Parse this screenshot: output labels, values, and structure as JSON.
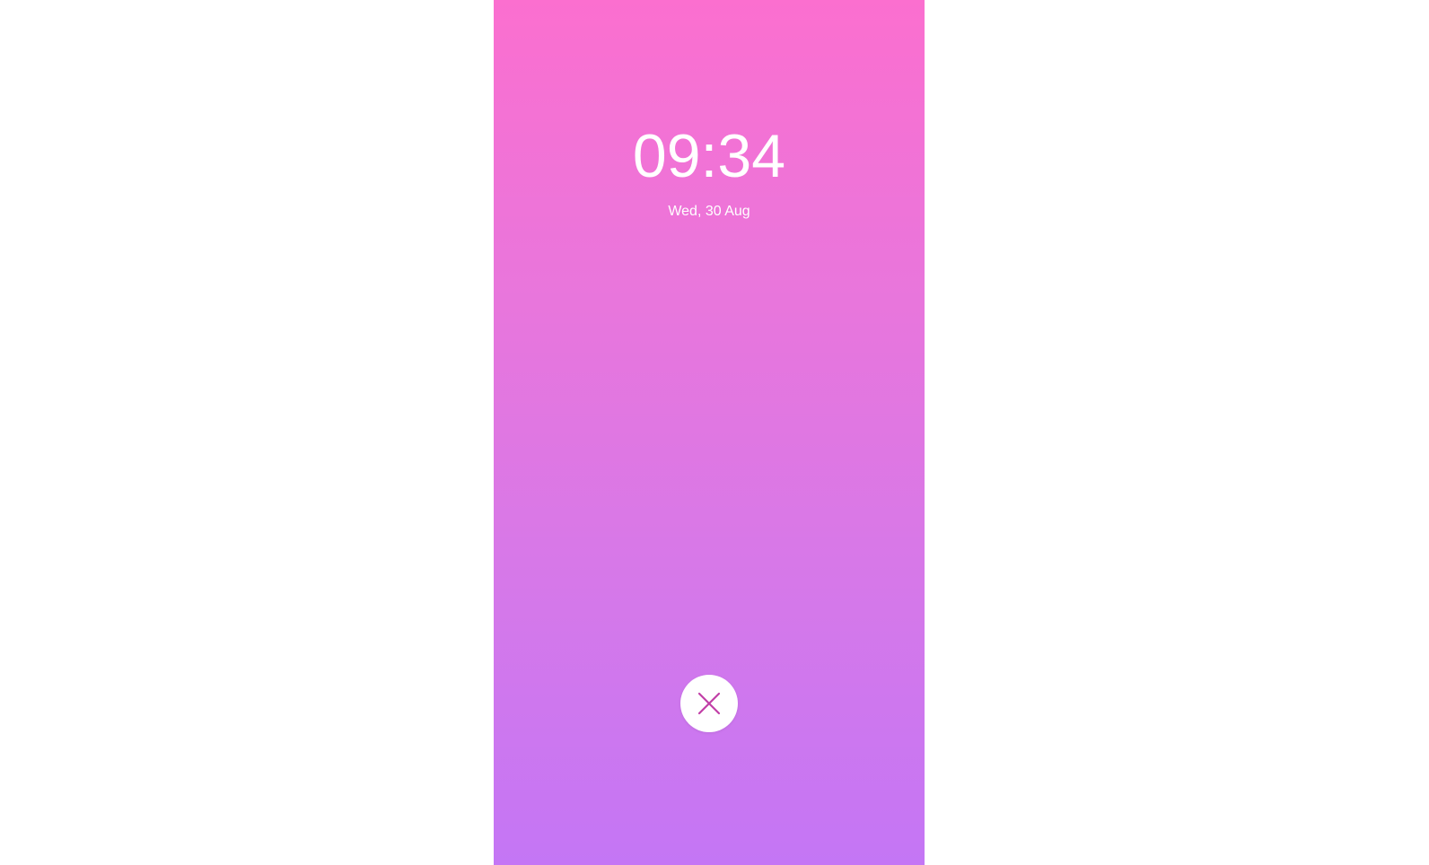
{
  "lock_screen": {
    "time": "09:34",
    "date": "Wed, 30 Aug"
  },
  "dismiss_button": {
    "icon": "close-icon",
    "icon_color": "#c13fa7",
    "background": "#ffffff"
  },
  "colors": {
    "gradient_top": "#fb6fcf",
    "gradient_bottom": "#c476f5",
    "text": "#ffffff"
  }
}
